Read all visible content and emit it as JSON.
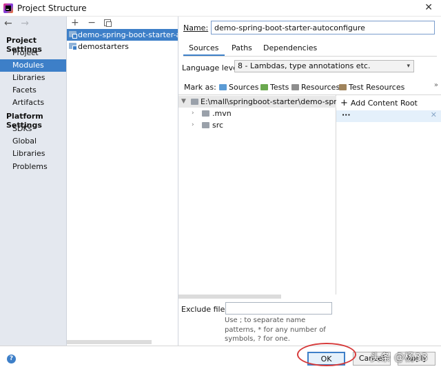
{
  "window": {
    "title": "Project Structure",
    "close_glyph": "✕"
  },
  "nav": {
    "back": "←",
    "forward": "→"
  },
  "left": {
    "project_settings": "Project Settings",
    "project_items": [
      "Project",
      "Modules",
      "Libraries",
      "Facets",
      "Artifacts"
    ],
    "platform_settings": "Platform Settings",
    "platform_items": [
      "SDKs",
      "Global Libraries"
    ],
    "problems": "Problems",
    "selected": "Modules"
  },
  "modules": {
    "tools": {
      "add": "+",
      "remove": "−"
    },
    "items": [
      "demo-spring-boot-starter-autoconfigure",
      "demostarters"
    ]
  },
  "detail": {
    "name_label": "Name:",
    "name_value": "demo-spring-boot-starter-autoconfigure",
    "tabs": [
      "Sources",
      "Paths",
      "Dependencies"
    ],
    "active_tab": "Sources",
    "language_label": "Language level:",
    "language_value": "8 - Lambdas, type annotations etc.",
    "mark_as_label": "Mark as:",
    "mark_buttons": [
      {
        "label": "Sources",
        "color": "#5b9bd5"
      },
      {
        "label": "Tests",
        "color": "#6aa84f"
      },
      {
        "label": "Resources",
        "color": "#8e8e8e"
      },
      {
        "label": "Test Resources",
        "color": "#a0845c"
      }
    ],
    "tree": {
      "root": "E:\\mall\\springboot-starter\\demo-spring-b",
      "children": [
        ".mvn",
        "src"
      ]
    },
    "content_root": {
      "add_label": "Add Content Root",
      "entry": "···"
    },
    "exclude_label": "Exclude files:",
    "exclude_help": "Use ; to separate name patterns, * for any number of symbols, ? for one."
  },
  "buttons": {
    "ok": "OK",
    "cancel": "Cancel",
    "apply": "Apply",
    "help": "?"
  },
  "watermark": "头条 @杨33",
  "colors": {
    "selection": "#3d7fc8",
    "highlight_circle": "#d63a3a"
  }
}
